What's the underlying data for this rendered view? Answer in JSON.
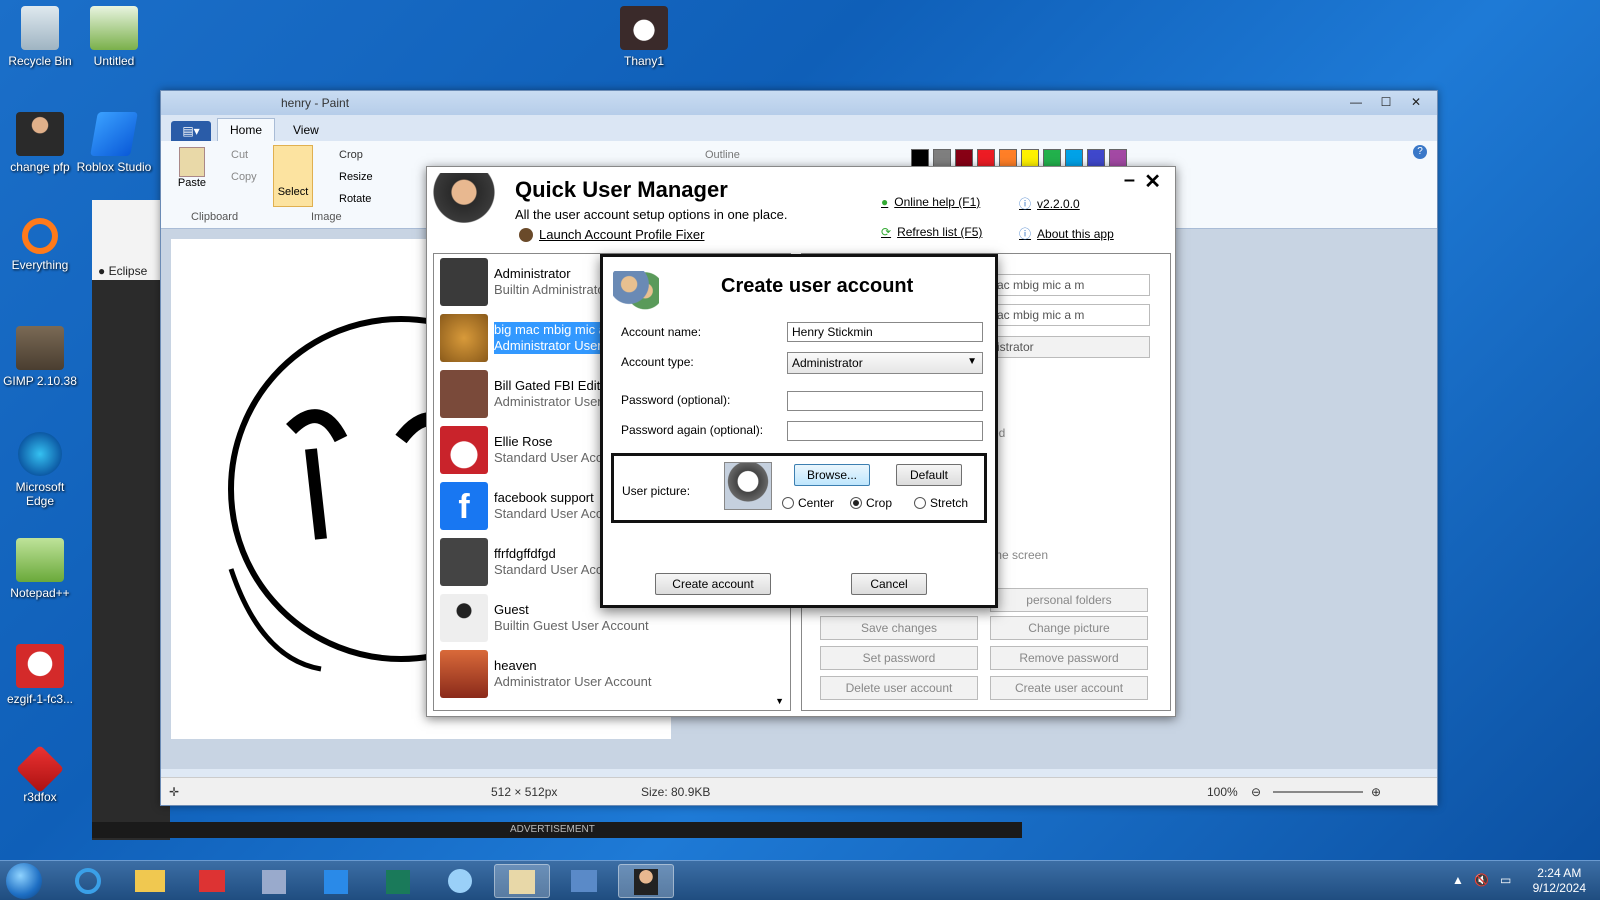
{
  "desktop": {
    "icons_left": [
      {
        "label": "Recycle Bin"
      },
      {
        "label": "change pfp"
      },
      {
        "label": "Everything"
      },
      {
        "label": "GIMP 2.10.38"
      },
      {
        "label": "Microsoft Edge"
      },
      {
        "label": "Notepad++"
      },
      {
        "label": "ezgif-1-fc3..."
      },
      {
        "label": "r3dfox"
      }
    ],
    "icons_col2": [
      {
        "label": "Untitled"
      },
      {
        "label": "Roblox Studio"
      }
    ],
    "icon_thany": {
      "label": "Thany1"
    }
  },
  "paint": {
    "title": "henry - Paint",
    "tabs": [
      "Home",
      "View"
    ],
    "clipboard": {
      "paste": "Paste",
      "cut": "Cut",
      "copy": "Copy",
      "group": "Clipboard"
    },
    "image": {
      "select": "Select",
      "crop": "Crop",
      "resize": "Resize",
      "rotate": "Rotate",
      "group": "Image"
    },
    "outline": "Outline",
    "status": {
      "dimensions": "512 × 512px",
      "size": "Size: 80.9KB",
      "zoom": "100%"
    },
    "palette": [
      "#000000",
      "#7f7f7f",
      "#880015",
      "#ed1c24",
      "#ff7f27",
      "#fff200",
      "#22b14c",
      "#00a2e8",
      "#3f48cc",
      "#a349a4"
    ]
  },
  "browser": {
    "tab_label": "Eclipse",
    "ad_label": "ADVERTISEMENT"
  },
  "qum": {
    "title": "Quick User Manager",
    "subtitle": "All the user account setup options in one place.",
    "launch_link": "Launch Account Profile Fixer",
    "online_help": "Online help (F1)",
    "version": "v2.2.0.0",
    "refresh": "Refresh list (F5)",
    "about": "About this app",
    "users": [
      {
        "name": "Administrator",
        "type": "Builtin Administrator",
        "color": "#3a3a3a"
      },
      {
        "name": "big mac mbig mic a",
        "type": "Administrator User",
        "color": "#b8792a",
        "selected": true
      },
      {
        "name": "Bill Gated FBI Edit",
        "type": "Administrator User",
        "color": "#7a4a3a"
      },
      {
        "name": "Ellie Rose",
        "type": "Standard User Acc",
        "color": "#c9232b"
      },
      {
        "name": "facebook support",
        "type": "Standard User Acc",
        "color": "#1877f2"
      },
      {
        "name": "ffrfdgffdfgd",
        "type": "Standard User Acc",
        "color": "#444444"
      },
      {
        "name": "Guest",
        "type": "Builtin Guest User Account",
        "color": "#eeeeee"
      },
      {
        "name": "heaven",
        "type": "Administrator User Account",
        "color": "#a34a2a"
      }
    ],
    "right": {
      "full_name": "ac mbig mic a m",
      "display_name": "ac mbig mic a m",
      "account_type": "istrator",
      "partial_text_1": "ed",
      "partial_text_2": "me screen",
      "personal_folders": "personal folders",
      "save_changes": "Save changes",
      "change_picture": "Change picture",
      "set_password": "Set password",
      "remove_password": "Remove password",
      "delete_account": "Delete user account",
      "create_account": "Create user account"
    }
  },
  "dialog": {
    "title": "Create user account",
    "account_name_label": "Account name:",
    "account_name_value": "Henry Stickmin",
    "account_type_label": "Account type:",
    "account_type_value": "Administrator",
    "password_label": "Password (optional):",
    "password_again_label": "Password again (optional):",
    "user_picture_label": "User picture:",
    "browse": "Browse...",
    "default": "Default",
    "radio_center": "Center",
    "radio_crop": "Crop",
    "radio_stretch": "Stretch",
    "selected_fit": "Crop",
    "create_btn": "Create account",
    "cancel_btn": "Cancel"
  },
  "taskbar": {
    "time": "2:24 AM",
    "date": "9/12/2024"
  }
}
